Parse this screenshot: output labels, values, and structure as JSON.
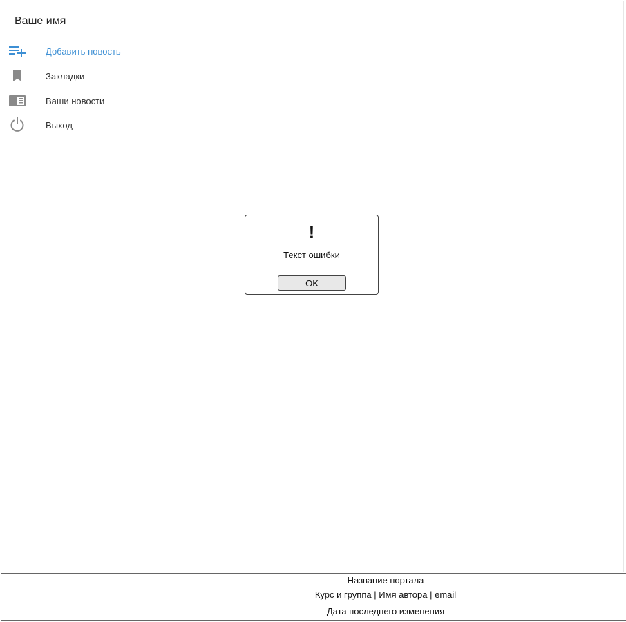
{
  "sidebar": {
    "user_name": "Ваше имя",
    "items": [
      {
        "label": "Добавить новость",
        "icon": "playlist-add-icon",
        "active": true
      },
      {
        "label": "Закладки",
        "icon": "bookmark-icon",
        "active": false
      },
      {
        "label": "Ваши новости",
        "icon": "news-icon",
        "active": false
      },
      {
        "label": "Выход",
        "icon": "power-icon",
        "active": false
      }
    ]
  },
  "dialog": {
    "icon": "exclamation-icon",
    "symbol": "!",
    "message": "Текст ошибки",
    "ok_label": "OK"
  },
  "footer": {
    "portal_name": "Название портала",
    "course_line": "Курс и группа | Имя автора | email",
    "last_modified": "Дата последнего изменения"
  },
  "colors": {
    "accent": "#3d8fd4",
    "icon_gray": "#8a8a8a"
  }
}
